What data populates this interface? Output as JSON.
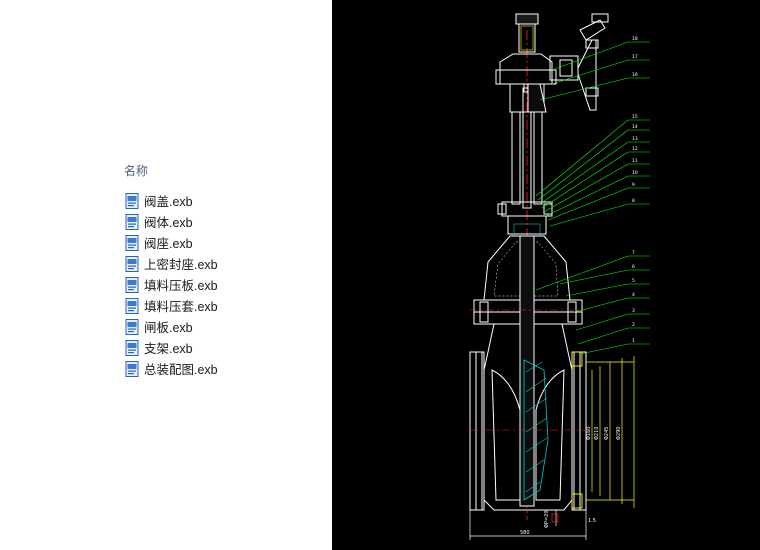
{
  "file_pane": {
    "column_header": "名称",
    "files": [
      {
        "name": "阀盖.exb"
      },
      {
        "name": "阀体.exb"
      },
      {
        "name": "阀座.exb"
      },
      {
        "name": "上密封座.exb"
      },
      {
        "name": "填料压板.exb"
      },
      {
        "name": "填料压套.exb"
      },
      {
        "name": "闸板.exb"
      },
      {
        "name": "支架.exb"
      },
      {
        "name": "总装配图.exb"
      }
    ],
    "icon": "exb-file-icon"
  },
  "drawing": {
    "callouts": [
      "18",
      "17",
      "16",
      "15",
      "14",
      "13",
      "12",
      "11",
      "10",
      "9",
      "8",
      "7",
      "6",
      "5",
      "4",
      "3",
      "2",
      "1"
    ],
    "dimension_labels": {
      "bottom_width": "580",
      "left_small": "ΦP=20",
      "right_1": "Φ160",
      "right_2": "Φ210",
      "right_3": "Φ245",
      "right_4": "Φ290",
      "bottom_right": "1.5"
    },
    "colors": {
      "background": "#000000",
      "outline": "#ffffff",
      "leader": "#00ff00",
      "centerline": "#ff2020",
      "hatch": "#00c8c8",
      "highlight": "#ffff00"
    }
  }
}
